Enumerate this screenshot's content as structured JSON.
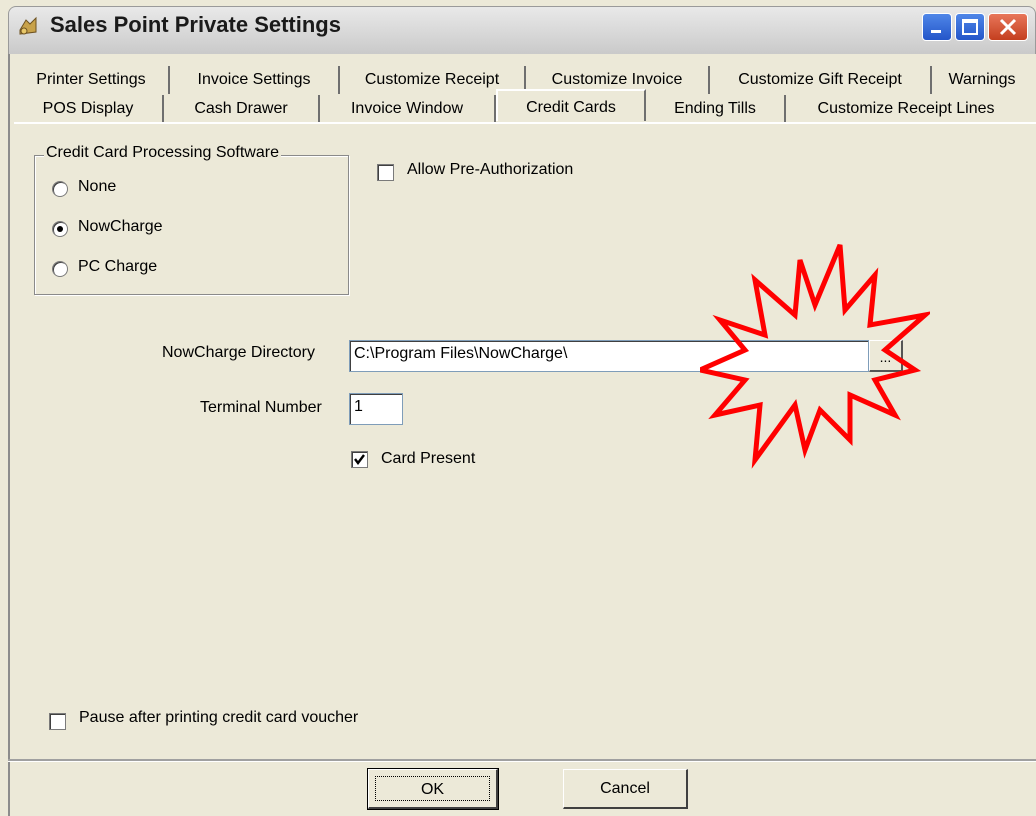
{
  "window": {
    "title": "Sales Point Private Settings"
  },
  "tabs": {
    "row1": [
      "Printer Settings",
      "Invoice Settings",
      "Customize Receipt",
      "Customize Invoice",
      "Customize Gift Receipt",
      "Warnings"
    ],
    "row2": [
      "POS Display",
      "Cash Drawer",
      "Invoice Window",
      "Credit Cards",
      "Ending Tills",
      "Customize Receipt Lines"
    ],
    "active": "Credit Cards"
  },
  "processing": {
    "legend": "Credit Card Processing Software",
    "options": [
      "None",
      "NowCharge",
      "PC Charge"
    ],
    "selected": "NowCharge"
  },
  "allow_preauth": {
    "label": "Allow Pre-Authorization",
    "checked": false
  },
  "directory": {
    "label": "NowCharge Directory",
    "value": "C:\\Program Files\\NowCharge\\",
    "browse_label": "..."
  },
  "terminal": {
    "label": "Terminal Number",
    "value": "1"
  },
  "card_present": {
    "label": "Card Present",
    "checked": true
  },
  "pause_voucher": {
    "label": "Pause after printing credit card voucher",
    "checked": false
  },
  "buttons": {
    "ok": "OK",
    "cancel": "Cancel"
  },
  "colors": {
    "burst_stroke": "#ff0000",
    "title_button_blue": "#2456c9",
    "close_red": "#c43f1f"
  }
}
